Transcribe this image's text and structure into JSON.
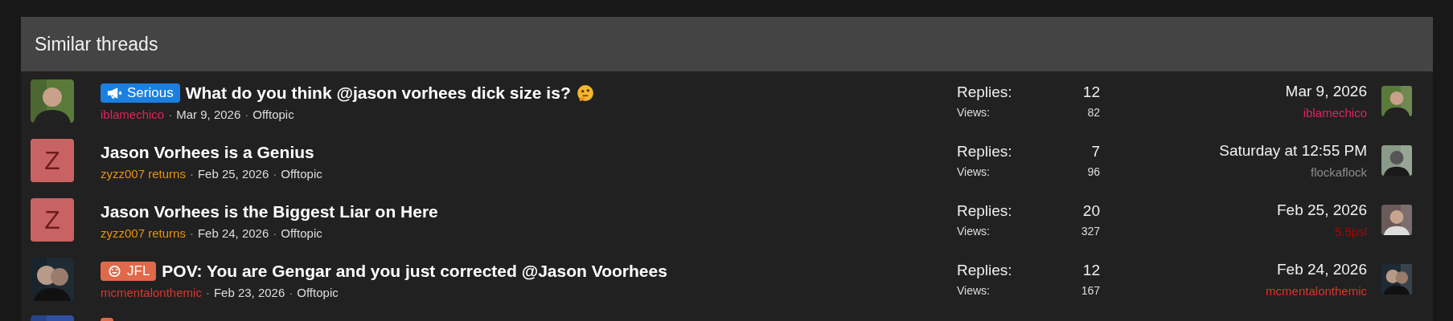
{
  "section": {
    "title": "Similar threads"
  },
  "threads": [
    {
      "prefix": {
        "kind": "serious",
        "label": "Serious",
        "color": "#1a7fe0"
      },
      "title": "What do you think @jason vorhees dick size is?",
      "title_emoji": true,
      "meta": [
        {
          "kind": "user",
          "text": "iblamechico",
          "color": "#e0245e"
        },
        {
          "kind": "sep",
          "text": "·"
        },
        {
          "kind": "date",
          "text": "Mar 9, 2026"
        },
        {
          "kind": "sep",
          "text": "·"
        },
        {
          "kind": "forum",
          "text": "Offtopic"
        }
      ],
      "replies_label": "Replies:",
      "replies": "12",
      "views_label": "Views:",
      "views": "82",
      "last_date": "Mar 9, 2026",
      "last_user": {
        "name": "iblamechico",
        "color": "#e0245e"
      }
    },
    {
      "avatar": {
        "kind": "letter",
        "letter": "Z",
        "color": "#c96363"
      },
      "title": "Jason Vorhees is a Genius",
      "meta": [
        {
          "kind": "user",
          "text": "zyzz007 returns",
          "color": "#e8930c"
        },
        {
          "kind": "sep",
          "text": "·"
        },
        {
          "kind": "date",
          "text": "Feb 25, 2026"
        },
        {
          "kind": "sep",
          "text": "·"
        },
        {
          "kind": "forum",
          "text": "Offtopic"
        }
      ],
      "replies_label": "Replies:",
      "replies": "7",
      "views_label": "Views:",
      "views": "96",
      "last_date": "Saturday at 12:55 PM",
      "last_user": {
        "name": "flockaflock",
        "color": "#8c8c8c"
      }
    },
    {
      "avatar": {
        "kind": "letter",
        "letter": "Z",
        "color": "#c96363"
      },
      "title": "Jason Vorhees is the Biggest Liar on Here",
      "meta": [
        {
          "kind": "user",
          "text": "zyzz007 returns",
          "color": "#e8930c"
        },
        {
          "kind": "sep",
          "text": "·"
        },
        {
          "kind": "date",
          "text": "Feb 24, 2026"
        },
        {
          "kind": "sep",
          "text": "·"
        },
        {
          "kind": "forum",
          "text": "Offtopic"
        }
      ],
      "replies_label": "Replies:",
      "replies": "20",
      "views_label": "Views:",
      "views": "327",
      "last_date": "Feb 25, 2026",
      "last_user": {
        "name": "5.5psl",
        "color": "#b30000"
      }
    },
    {
      "prefix": {
        "kind": "jfl",
        "label": "JFL",
        "color": "#e0694a"
      },
      "title": "POV: You are Gengar and you just corrected @Jason Voorhees",
      "meta": [
        {
          "kind": "user",
          "text": "mcmentalonthemic",
          "color": "#d9372e"
        },
        {
          "kind": "sep",
          "text": "·"
        },
        {
          "kind": "date",
          "text": "Feb 23, 2026"
        },
        {
          "kind": "sep",
          "text": "·"
        },
        {
          "kind": "forum",
          "text": "Offtopic"
        }
      ],
      "replies_label": "Replies:",
      "replies": "12",
      "views_label": "Views:",
      "views": "167",
      "last_date": "Feb 24, 2026",
      "last_user": {
        "name": "mcmentalonthemic",
        "color": "#d9372e"
      }
    },
    {
      "prefix": {
        "kind": "blank",
        "color": "#e0694a"
      }
    }
  ]
}
